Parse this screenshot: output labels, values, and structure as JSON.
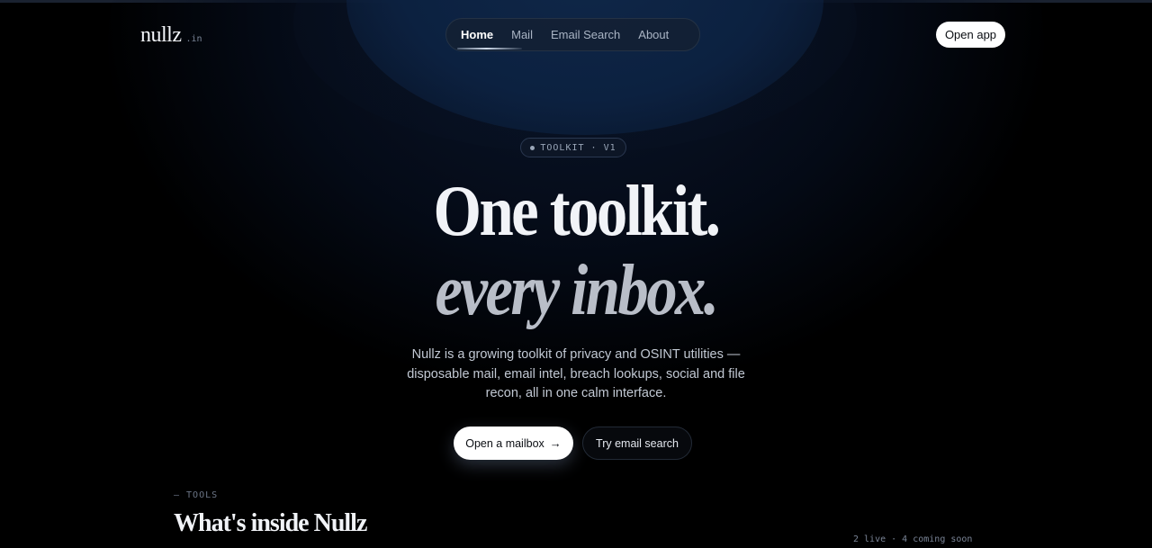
{
  "header": {
    "logo": "nullz",
    "logo_suffix": ".in",
    "nav": [
      {
        "label": "Home",
        "active": true
      },
      {
        "label": "Mail",
        "active": false
      },
      {
        "label": "Email Search",
        "active": false
      },
      {
        "label": "About",
        "active": false
      }
    ],
    "open_app_label": "Open app"
  },
  "hero": {
    "badge": "TOOLKIT · V1",
    "headline_line1": "One toolkit.",
    "headline_line2": "every inbox.",
    "subcopy": "Nullz is a growing toolkit of privacy and OSINT utilities — disposable mail, email intel, breach lookups, social and file recon, all in one calm interface.",
    "primary_cta": "Open a mailbox",
    "secondary_cta": "Try email search"
  },
  "tools": {
    "eyebrow": "— TOOLS",
    "title": "What's inside Nullz",
    "status": "2 live · 4 coming soon"
  },
  "colors": {
    "background": "#000000",
    "glow": "#0c2140",
    "primary_button": "#ffffff"
  },
  "icons": {
    "primary_cta_icon": "arrow-right-icon"
  }
}
